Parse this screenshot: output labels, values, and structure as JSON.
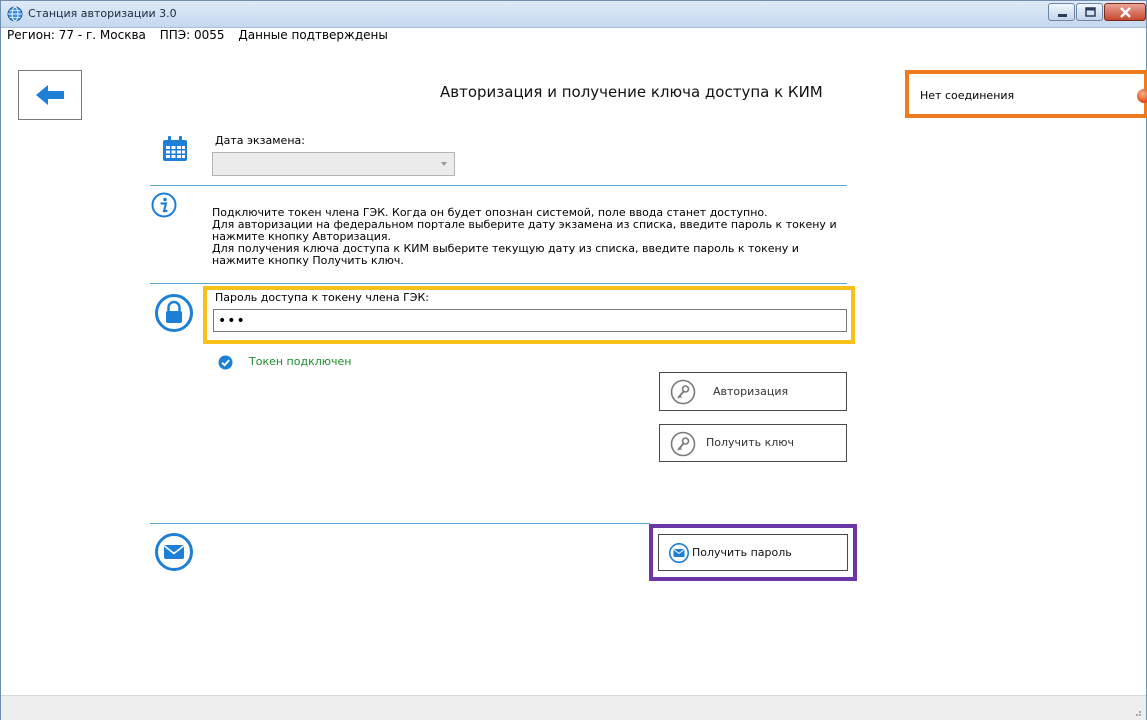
{
  "window": {
    "title": "Станция авторизации 3.0",
    "minimize_icon": "minimize-icon",
    "maximize_icon": "maximize-icon",
    "close_icon": "close-icon"
  },
  "status_line": {
    "region": "Регион: 77 - г. Москва",
    "ppe": "ППЭ: 0055",
    "data_status": "Данные подтверждены"
  },
  "header": {
    "back_icon": "arrow-left-icon",
    "title": "Авторизация и получение ключа доступа к КИМ"
  },
  "connection": {
    "text": "Нет соединения",
    "status_color": "#e04714",
    "highlight_color": "#ee7b1e"
  },
  "exam_date": {
    "label": "Дата экзамена:",
    "value": "",
    "icon": "calendar-icon"
  },
  "info": {
    "icon": "info-icon",
    "lines": [
      "Подключите токен члена ГЭК. Когда он будет опознан системой, поле ввода станет доступно.",
      "Для авторизации на федеральном портале выберите дату экзамена из списка, введите пароль к токену и",
      "нажмите кнопку Авторизация.",
      "Для получения ключа доступа к КИМ выберите текущую дату из списка, введите пароль к токену и",
      "нажмите кнопку Получить ключ."
    ]
  },
  "password": {
    "icon": "lock-icon",
    "label": "Пароль доступа к токену члена ГЭК:",
    "value": "•••",
    "highlight_color": "#f8c018"
  },
  "token": {
    "icon": "check-circle-icon",
    "status": "Токен подключен",
    "color": "#1c8a2a"
  },
  "buttons": {
    "authorize": "Авторизация",
    "get_key": "Получить ключ",
    "get_password": "Получить пароль",
    "key_icon": "key-icon",
    "mail_icon": "mail-icon"
  },
  "mail_section": {
    "icon": "envelope-icon",
    "highlight_color": "#6c36a7"
  },
  "accent_color": "#1d7fd6"
}
